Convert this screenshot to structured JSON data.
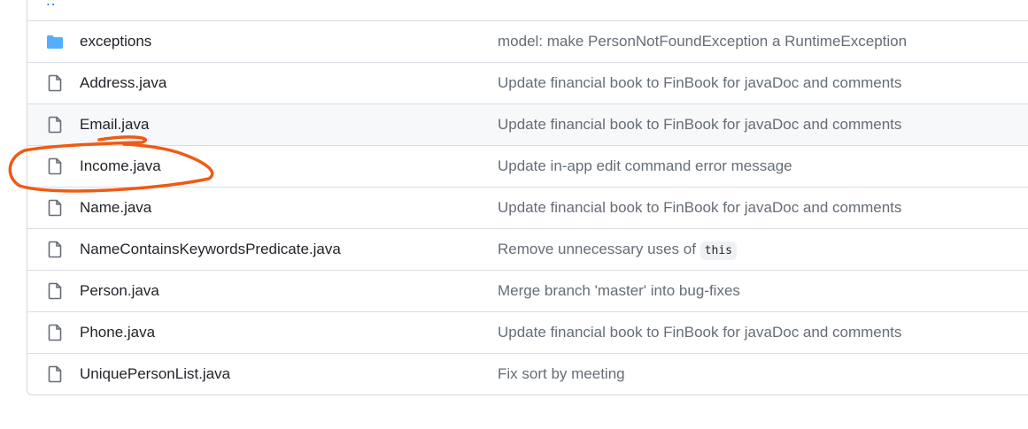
{
  "parent_dir": {
    "label": ".."
  },
  "files": [
    {
      "name": "exceptions",
      "type": "folder",
      "message": "model: make PersonNotFoundException a RuntimeException"
    },
    {
      "name": "Address.java",
      "type": "file",
      "message": "Update financial book to FinBook for javaDoc and comments"
    },
    {
      "name": "Email.java",
      "type": "file",
      "message": "Update financial book to FinBook for javaDoc and comments"
    },
    {
      "name": "Income.java",
      "type": "file",
      "message": "Update in-app edit command error message"
    },
    {
      "name": "Name.java",
      "type": "file",
      "message": "Update financial book to FinBook for javaDoc and comments"
    },
    {
      "name": "NameContainsKeywordsPredicate.java",
      "type": "file",
      "message": "Remove unnecessary uses of",
      "code": "this"
    },
    {
      "name": "Person.java",
      "type": "file",
      "message": "Merge branch 'master' into bug-fixes"
    },
    {
      "name": "Phone.java",
      "type": "file",
      "message": "Update financial book to FinBook for javaDoc and comments"
    },
    {
      "name": "UniquePersonList.java",
      "type": "file",
      "message": "Fix sort by meeting"
    }
  ],
  "colors": {
    "folder_icon": "#54aeff",
    "file_icon": "#656d76",
    "annotation": "#f05a14"
  },
  "icons": {
    "folder": "folder-icon",
    "file": "file-icon"
  }
}
